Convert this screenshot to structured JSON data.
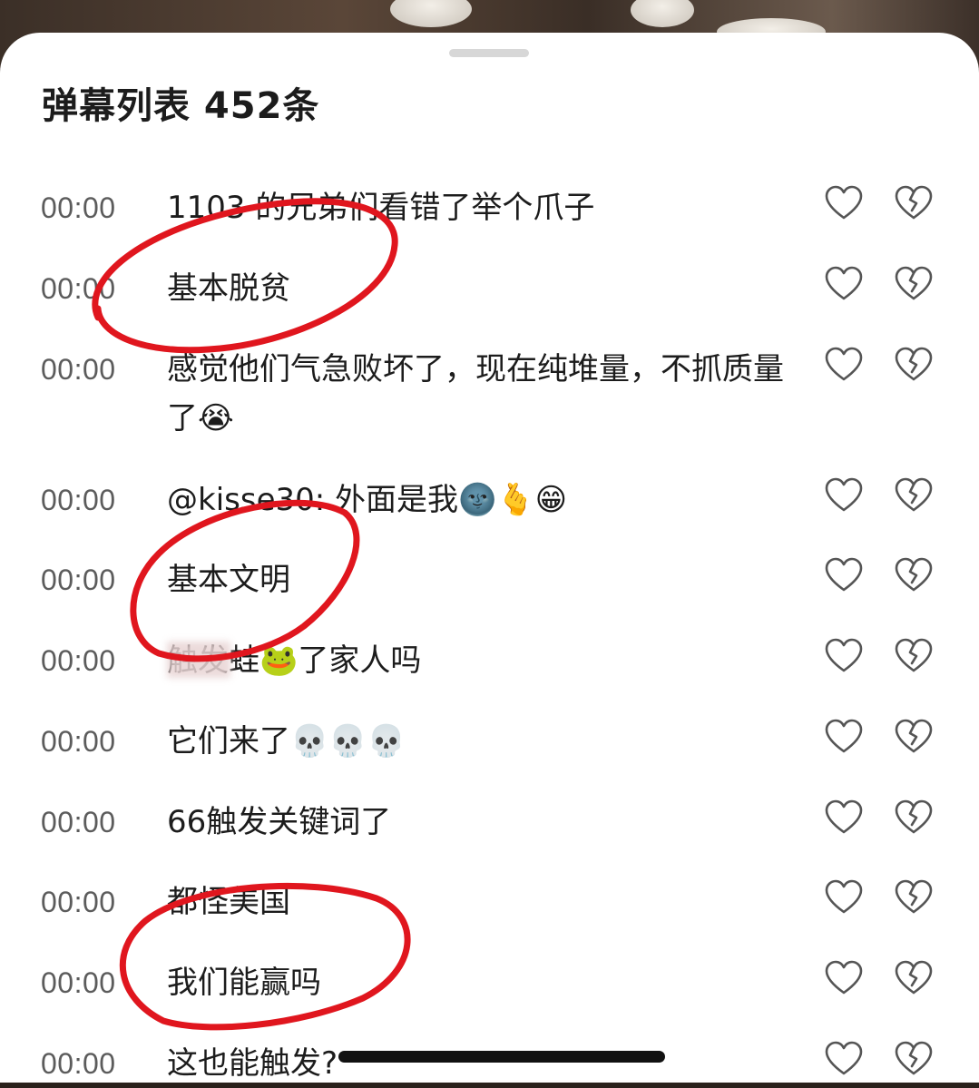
{
  "header": {
    "title": "弹幕列表 452条"
  },
  "danmaku": [
    {
      "time": "00:00",
      "text": "1103 的兄弟们看错了举个爪子"
    },
    {
      "time": "00:00",
      "text": "基本脱贫"
    },
    {
      "time": "00:00",
      "text": "感觉他们气急败坏了，现在纯堆量，不抓质量了😭"
    },
    {
      "time": "00:00",
      "text": "@kisse30: 外面是我🌚🫰😁"
    },
    {
      "time": "00:00",
      "text": "基本文明"
    },
    {
      "time": "00:00",
      "text": "触发蛙🐸了家人吗"
    },
    {
      "time": "00:00",
      "text": "它们来了💀💀💀"
    },
    {
      "time": "00:00",
      "text": "66触发关键词了"
    },
    {
      "time": "00:00",
      "text": "都怪美国"
    },
    {
      "time": "00:00",
      "text": "我们能赢吗"
    },
    {
      "time": "00:00",
      "text": "这也能触发?"
    }
  ],
  "icons": {
    "like": "heart-outline-icon",
    "dislike": "broken-heart-icon"
  },
  "colors": {
    "annotation": "#e0161e",
    "text": "#1c1c1c",
    "time": "#5c5c5c",
    "icon": "#555555"
  }
}
